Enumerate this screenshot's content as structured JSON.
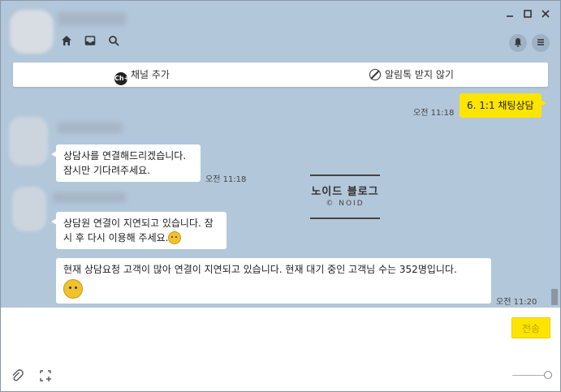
{
  "header": {
    "icons": [
      "home-icon",
      "inbox-icon",
      "search-icon"
    ],
    "window_controls": [
      "minimize-icon",
      "maximize-icon",
      "close-icon"
    ],
    "right_buttons": [
      "bell-icon",
      "menu-icon"
    ]
  },
  "channel_bar": {
    "add_channel_label": "채널 추가",
    "ch_badge": "Ch+",
    "block_notifications_label": "알림톡 받지 않기"
  },
  "messages": {
    "my_message": {
      "text": "6. 1:1 채팅상담",
      "time": "오전 11:18"
    },
    "incoming_1": {
      "line1": "상담사를 연결해드리겠습니다.",
      "line2": "잠시만 기다려주세요.",
      "time": "오전 11:18"
    },
    "incoming_2": {
      "line1": "상담원 연결이 지연되고 있습니다. 잠",
      "line2": "시 후 다시 이용해 주세요."
    },
    "incoming_3": {
      "text": "현재 상담요청 고객이 많아 연결이 지연되고 있습니다. 현재 대기 중인 고객님 수는 352명입니다.",
      "time": "오전 11:20"
    }
  },
  "watermark": {
    "title": "노이드 블로그",
    "subtitle": "© NOID"
  },
  "input_area": {
    "send_label": "전송",
    "icons": [
      "paperclip-icon",
      "capture-icon"
    ]
  },
  "colors": {
    "chat_bg": "#b2c7da",
    "my_bubble": "#fee500",
    "in_bubble": "#ffffff"
  }
}
